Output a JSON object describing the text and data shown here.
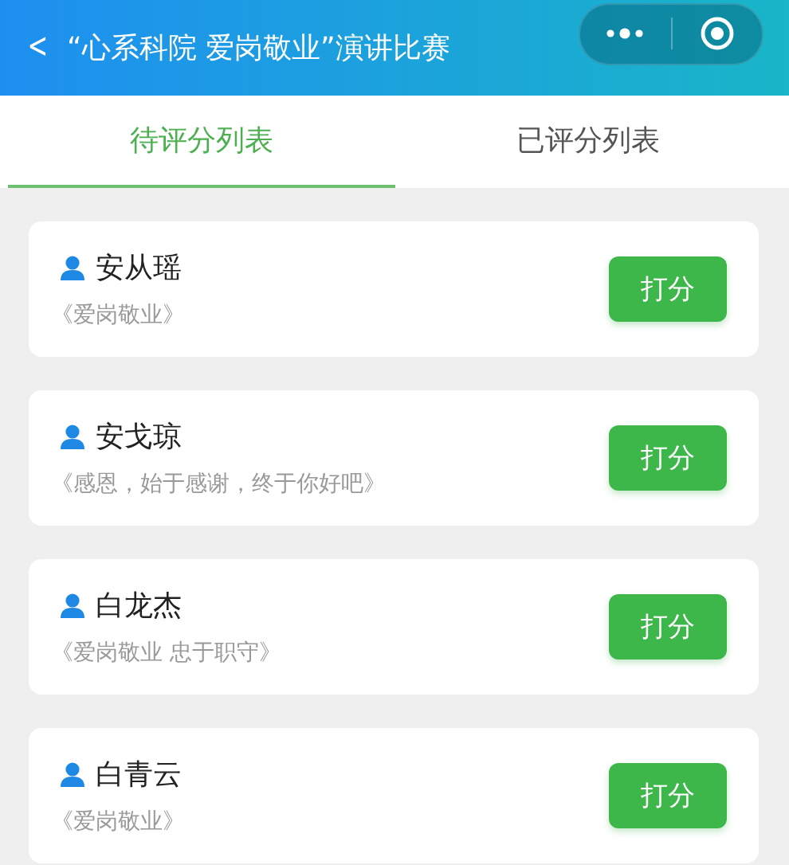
{
  "header": {
    "back_icon": "<",
    "title": "“心系科院 爱岗敬业”演讲比赛"
  },
  "tabs": [
    {
      "label": "待评分列表",
      "selected": true
    },
    {
      "label": "已评分列表",
      "selected": false
    }
  ],
  "entries": [
    {
      "name": "安从瑶",
      "speech": "《爱岗敬业》",
      "button": "打分"
    },
    {
      "name": "安戈琼",
      "speech": "《感恩，始于感谢，终于你好吧》",
      "button": "打分"
    },
    {
      "name": "白龙杰",
      "speech": "《爱岗敬业 忠于职守》",
      "button": "打分"
    },
    {
      "name": "白青云",
      "speech": "《爱岗敬业》",
      "button": "打分"
    }
  ]
}
